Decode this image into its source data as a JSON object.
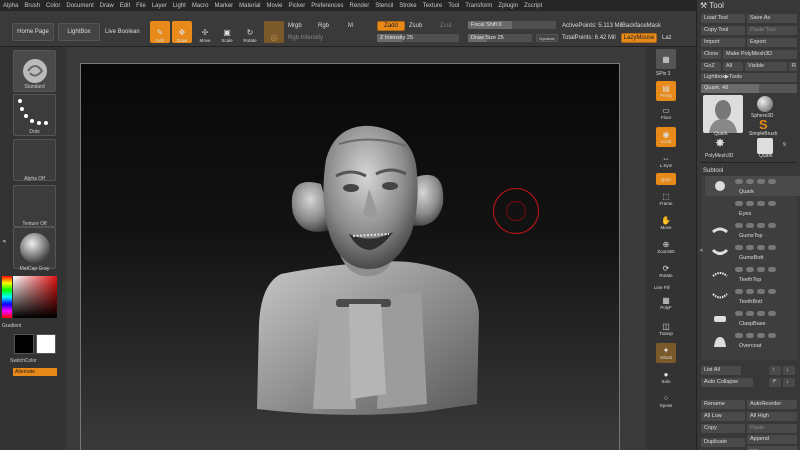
{
  "menu": [
    "Alpha",
    "Brush",
    "Color",
    "Document",
    "Draw",
    "Edit",
    "File",
    "Layer",
    "Light",
    "Macro",
    "Marker",
    "Material",
    "Movie",
    "Picker",
    "Preferences",
    "Render",
    "Stencil",
    "Stroke",
    "Texture",
    "Tool",
    "Transform",
    "Zplugin",
    "Zscript"
  ],
  "toolbar": {
    "home_page": "Home Page",
    "lightbox": "LightBox",
    "live_boolean": "Live Boolean",
    "edit": "Edit",
    "draw": "Draw",
    "move": "Move",
    "scale": "Scale",
    "rotate": "Rotate",
    "mrgb": "Mrgb",
    "rgb": "Rgb",
    "m": "M",
    "rgb_intensity": "Rgb Intensity",
    "zadd": "Zadd",
    "zsub": "Zsub",
    "zcut": "Zcut",
    "z_intensity": "Z Intensity 25",
    "z_intensity_value": 25,
    "focal_shift": "Focal Shift 0",
    "draw_size": "Draw Size 25",
    "dynamic": "Dynamic",
    "active_points": "ActivePoints: 5.113 Mil",
    "total_points": "TotalPoints: 6.42 Mil",
    "backface_mask": "BackfaceMask",
    "lazymouse": "LazyMouse",
    "laz": "Laz"
  },
  "left": {
    "brush": "Standard",
    "stroke": "Dots",
    "alpha": "Alpha Off",
    "texture": "Texture Off",
    "material": "MatCap Gray",
    "gradient": "Gradient",
    "switch_color": "SwitchColor",
    "alternate": "Alternate"
  },
  "right_strip": {
    "spix": "SPix 3",
    "persp": "Persp",
    "floor": "Floor",
    "local": "Local",
    "lsym": "L.Sym",
    "xyz": "Qxyz",
    "frame": "Frame",
    "move": "Move",
    "zoom3d": "Zoom3D",
    "rotate": "Rotate",
    "line_fill": "Line Fill",
    "polyf": "PolyF",
    "transp": "Transp",
    "ghost": "Ghost",
    "solo": "Solo",
    "xpose": "Xpose"
  },
  "tool": {
    "title": "Tool",
    "load_tool": "Load Tool",
    "save_as": "Save As",
    "copy_tool": "Copy Tool",
    "paste_tool": "Paste Tool",
    "import": "Import",
    "export": "Export",
    "clone": "Clone",
    "make_polymesh": "Make PolyMesh3D",
    "goz": "GoZ",
    "all": "All",
    "visible": "Visible",
    "r": "R",
    "lightbox_tools": "Lightbox▶Tools",
    "quark_slider": "Quark. 48",
    "quark_value": 48,
    "thumbs": [
      "Quark",
      "Sphere3D",
      "SimpleBrush",
      "PolyMesh3D",
      "Quark"
    ],
    "thumb_count": "9",
    "subtool_title": "Subtool",
    "subtools": [
      "Quark",
      "Eyes",
      "GumsTop",
      "GumsBott",
      "TeethTop",
      "TeethBott",
      "ClaspBase",
      "Overcoat"
    ],
    "list_all": "List All",
    "auto_collapse": "Auto Collapse",
    "rename": "Rename",
    "auto_reorder": "AutoReorder",
    "all_low": "All Low",
    "all_high": "All High",
    "copy": "Copy",
    "paste": "Paste",
    "duplicate": "Duplicate",
    "append": "Append",
    "insert": "Insert"
  },
  "colors": {
    "accent": "#e88a1a",
    "panel": "#383838",
    "canvas": "#0c0c0c",
    "cursor": "#c0141c"
  },
  "icons": [
    "wrench-icon",
    "move-icon",
    "scale-icon",
    "rotate-icon",
    "brush-icon"
  ]
}
